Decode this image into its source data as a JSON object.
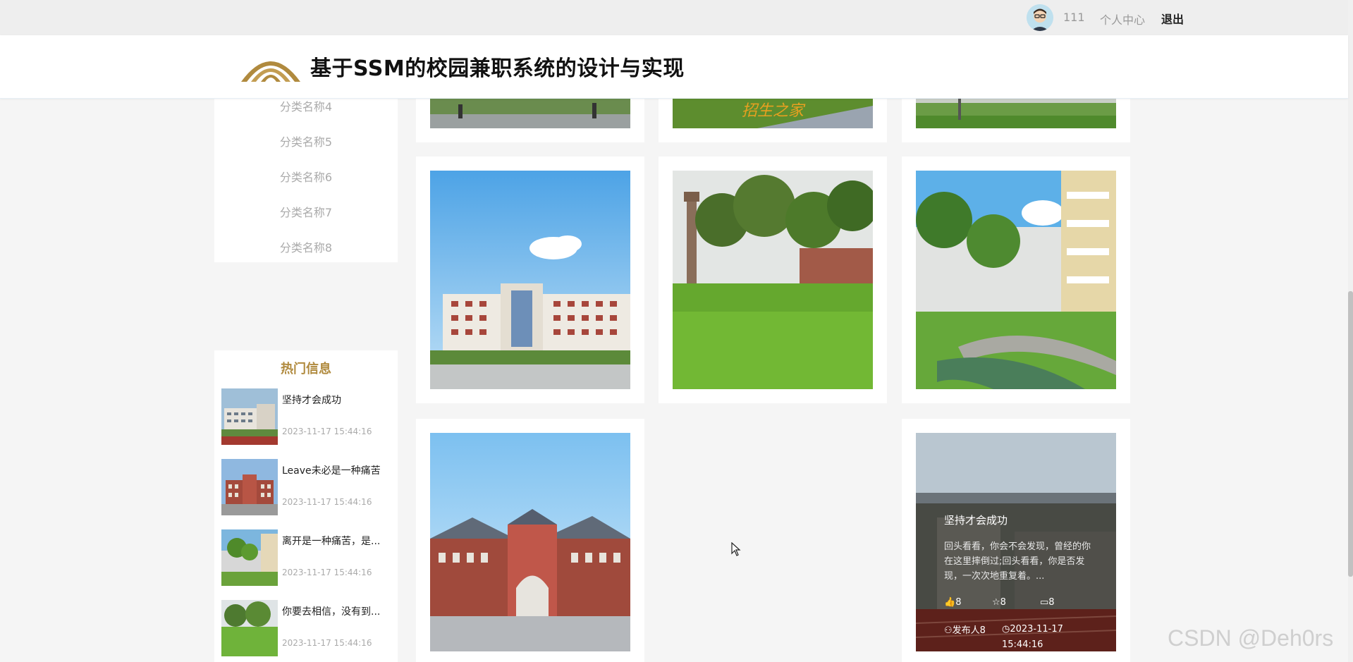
{
  "top_bar": {
    "username": "111",
    "personal_center": "个人中心",
    "logout": "退出"
  },
  "header": {
    "site_title": "基于SSM的校园兼职系统的设计与实现"
  },
  "categories": [
    "分类名称4",
    "分类名称5",
    "分类名称6",
    "分类名称7",
    "分类名称8"
  ],
  "hot": {
    "title": "热门信息",
    "items": [
      {
        "title": "坚持才会成功",
        "time": "2023-11-17 15:44:16"
      },
      {
        "title": "Leave未必是一种痛苦",
        "time": "2023-11-17 15:44:16"
      },
      {
        "title": "离开是一种痛苦，是...",
        "time": "2023-11-17 15:44:16"
      },
      {
        "title": "你要去相信，没有到...",
        "time": "2023-11-17 15:44:16"
      }
    ]
  },
  "banner_text": "招生之家",
  "overlay_card": {
    "title": "坚持才会成功",
    "desc": "回头看看，你会不会发现，曾经的你在这里摔倒过;回头看看，你是否发现，一次次地重复着。...",
    "likes": "8",
    "favorites": "8",
    "comments": "8",
    "publisher": "发布人8",
    "time": "2023-11-17 15:44:16"
  },
  "watermark": "CSDN @Deh0rs",
  "colors": {
    "accent_gold": "#b08a3e",
    "panel_bg": "#ffffff",
    "page_bg": "#f5f5f5"
  },
  "icons": [
    "avatar",
    "logo-arch-icon",
    "like-icon",
    "star-icon",
    "comment-icon",
    "user-icon",
    "clock-icon",
    "mouse-cursor-icon"
  ]
}
